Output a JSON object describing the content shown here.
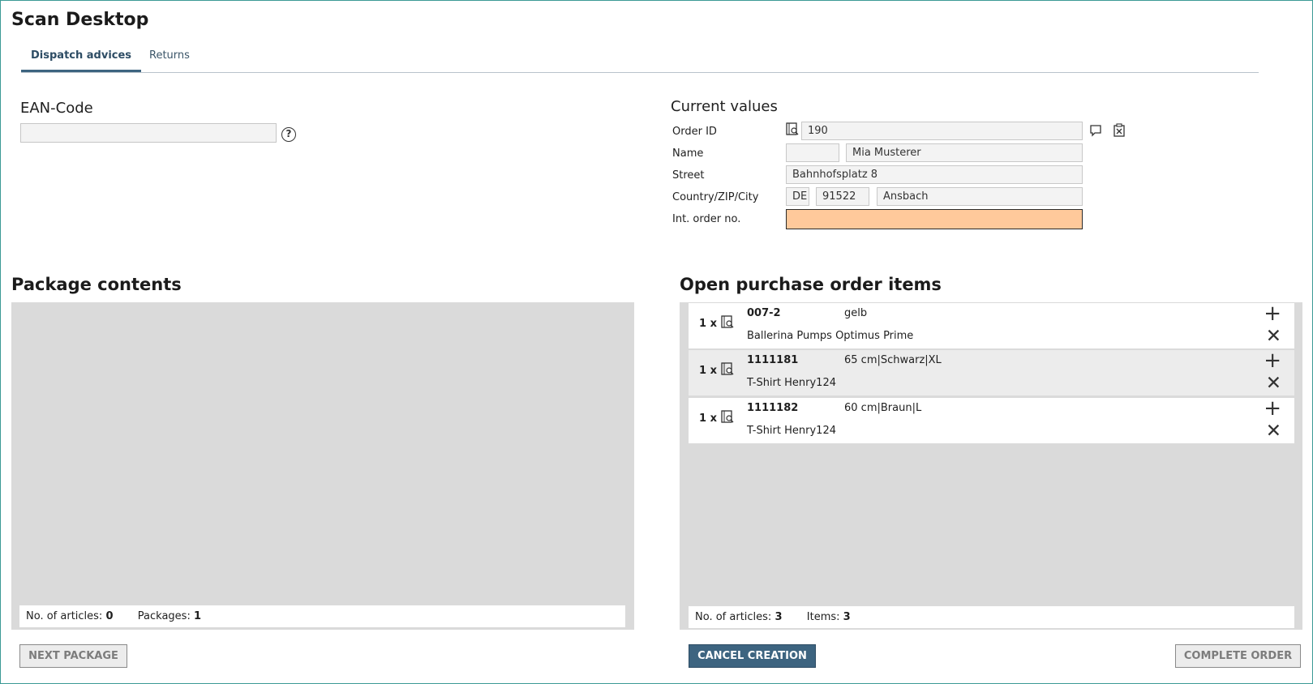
{
  "page": {
    "title": "Scan Desktop"
  },
  "tabs": [
    {
      "label": "Dispatch advices",
      "active": true
    },
    {
      "label": "Returns",
      "active": false
    }
  ],
  "ean": {
    "label": "EAN-Code",
    "value": "",
    "help_icon": "question-circle-icon"
  },
  "current_values": {
    "title": "Current values",
    "order_id": {
      "label": "Order ID",
      "value": "190"
    },
    "name": {
      "label": "Name",
      "salutation": "",
      "value": "Mia Musterer"
    },
    "street": {
      "label": "Street",
      "value": "Bahnhofsplatz 8"
    },
    "location": {
      "label": "Country/ZIP/City",
      "country": "DE",
      "zip": "91522",
      "city": "Ansbach"
    },
    "int_order": {
      "label": "Int. order no.",
      "value": ""
    }
  },
  "package": {
    "title": "Package contents",
    "articles_label": "No. of articles:",
    "articles_count": "0",
    "packages_label": "Packages:",
    "packages_count": "1"
  },
  "open_items": {
    "title": "Open purchase order items",
    "items": [
      {
        "qty": "1 x",
        "code": "007-2",
        "variant": "gelb",
        "name": "Ballerina Pumps Optimus Prime"
      },
      {
        "qty": "1 x",
        "code": "1111181",
        "variant": "65 cm|Schwarz|XL",
        "name": "T-Shirt Henry124"
      },
      {
        "qty": "1 x",
        "code": "1111182",
        "variant": "60 cm|Braun|L",
        "name": "T-Shirt Henry124"
      }
    ],
    "articles_label": "No. of articles:",
    "articles_count": "3",
    "items_label": "Items:",
    "items_count": "3"
  },
  "buttons": {
    "next_package": "Next package",
    "cancel_creation": "Cancel creation",
    "complete_order": "Complete order"
  },
  "colors": {
    "accent": "#3d6480",
    "highlight_field": "#ffc99b",
    "panel_bg": "#dadada",
    "row_alt": "#ececec"
  }
}
